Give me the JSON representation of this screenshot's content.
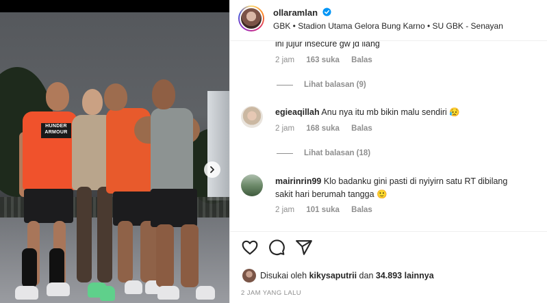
{
  "post": {
    "author": "ollaramlan",
    "location": "GBK • Stadion Utama Gelora Bung Karno • SU GBK - Senayan",
    "jersey_text_1": "HUNDER",
    "jersey_text_2": "ARMOUR"
  },
  "comments": [
    {
      "username": "",
      "text": "ini jujur insecure gw jd ilang",
      "time": "2 jam",
      "likes": "163 suka",
      "reply": "Balas",
      "view_replies": "Lihat balasan (9)"
    },
    {
      "username": "egieaqillah",
      "text": "Anu nya itu mb bikin malu sendiri",
      "emoji": "😥",
      "time": "2 jam",
      "likes": "168 suka",
      "reply": "Balas",
      "view_replies": "Lihat balasan (18)"
    },
    {
      "username": "mairinrin99",
      "text_line1": "Klo badanku gini pasti di nyiyirn satu RT dibilang",
      "text_line2": "sakit hari berumah tangga",
      "emoji": "🙂",
      "time": "2 jam",
      "likes": "101 suka",
      "reply": "Balas"
    }
  ],
  "likes": {
    "prefix": "Disukai oleh",
    "user": "kikysaputrii",
    "middle": "dan",
    "count": "34.893 lainnya"
  },
  "timestamp": "2 JAM YANG LALU",
  "icons": [
    "verified-icon",
    "heart-icon",
    "comment-icon",
    "share-icon",
    "next-arrow-icon"
  ],
  "colors": {
    "verified": "#0095f6",
    "muted": "#8e8e8e",
    "text": "#262626"
  }
}
